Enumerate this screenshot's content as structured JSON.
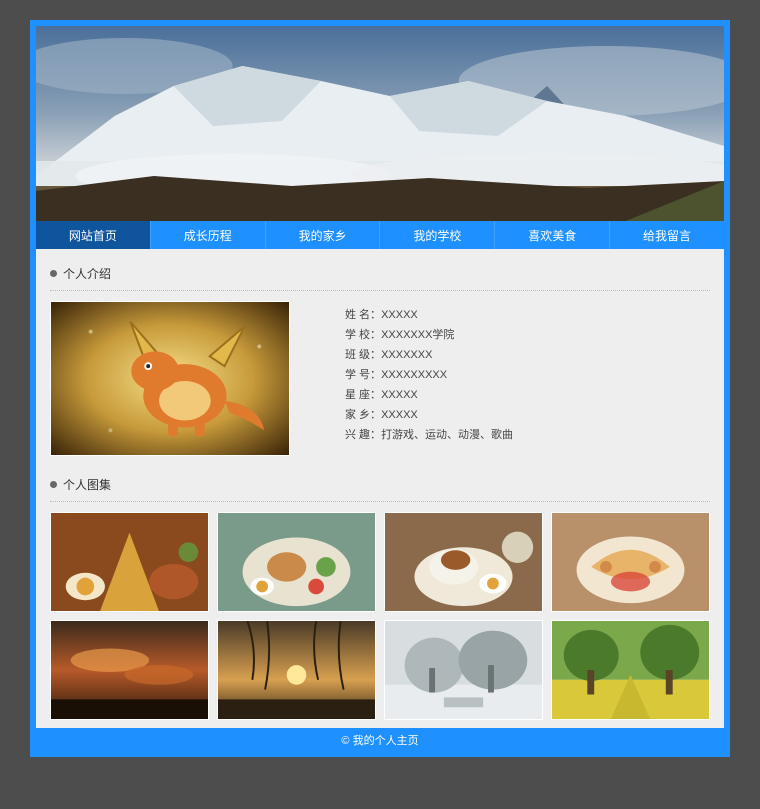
{
  "nav": {
    "items": [
      {
        "label": "网站首页",
        "active": true
      },
      {
        "label": "成长历程",
        "active": false
      },
      {
        "label": "我的家乡",
        "active": false
      },
      {
        "label": "我的学校",
        "active": false
      },
      {
        "label": "喜欢美食",
        "active": false
      },
      {
        "label": "给我留言",
        "active": false
      }
    ]
  },
  "sections": {
    "intro_title": "个人介绍",
    "gallery_title": "个人图集"
  },
  "profile": {
    "rows": [
      {
        "label": "姓 名：",
        "value": "XXXXX"
      },
      {
        "label": "学 校：",
        "value": "XXXXXXX学院"
      },
      {
        "label": "班 级：",
        "value": "XXXXXXX"
      },
      {
        "label": "学 号：",
        "value": "XXXXXXXXX"
      },
      {
        "label": "星 座：",
        "value": "XXXXX"
      },
      {
        "label": "家 乡：",
        "value": "XXXXX"
      },
      {
        "label": "兴 趣：",
        "value": "打游戏、运动、动漫、歌曲"
      }
    ]
  },
  "gallery": {
    "items": [
      {
        "name": "gallery-thumb-1"
      },
      {
        "name": "gallery-thumb-2"
      },
      {
        "name": "gallery-thumb-3"
      },
      {
        "name": "gallery-thumb-4"
      },
      {
        "name": "gallery-thumb-5"
      },
      {
        "name": "gallery-thumb-6"
      },
      {
        "name": "gallery-thumb-7"
      },
      {
        "name": "gallery-thumb-8"
      }
    ]
  },
  "footer": {
    "text": "© 我的个人主页"
  }
}
